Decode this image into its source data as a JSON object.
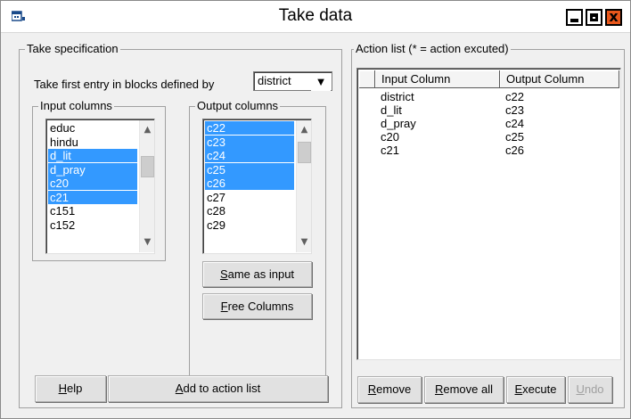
{
  "window": {
    "title": "Take data",
    "icon": "app-icon",
    "controls": [
      "minimize-icon",
      "maximize-icon",
      "close-icon"
    ],
    "close_glyph": "x"
  },
  "take_spec": {
    "group_title": "Take specification",
    "blocks_label": "Take first entry in blocks defined by",
    "blocks_value": "district",
    "dropdown_arrow": "▼",
    "input_columns": {
      "title": "Input columns",
      "items": [
        {
          "label": "educ",
          "selected": false
        },
        {
          "label": "hindu",
          "selected": false
        },
        {
          "label": "d_lit",
          "selected": true
        },
        {
          "label": "d_pray",
          "selected": true
        },
        {
          "label": "c20",
          "selected": true
        },
        {
          "label": "c21",
          "selected": true
        },
        {
          "label": "c151",
          "selected": false
        },
        {
          "label": "c152",
          "selected": false
        }
      ]
    },
    "output_columns": {
      "title": "Output columns",
      "items": [
        {
          "label": "c22",
          "selected": true
        },
        {
          "label": "c23",
          "selected": true
        },
        {
          "label": "c24",
          "selected": true
        },
        {
          "label": "c25",
          "selected": true
        },
        {
          "label": "c26",
          "selected": true
        },
        {
          "label": "c27",
          "selected": false
        },
        {
          "label": "c28",
          "selected": false
        },
        {
          "label": "c29",
          "selected": false
        }
      ]
    },
    "same_as_input": {
      "prefix": "",
      "accel": "S",
      "rest": "ame as input"
    },
    "free_columns": {
      "prefix": "",
      "accel": "F",
      "rest": "ree Columns"
    },
    "help": {
      "prefix": "",
      "accel": "H",
      "rest": "elp"
    },
    "add_to_action_list": {
      "prefix": "",
      "accel": "A",
      "rest": "dd to action list"
    }
  },
  "action_list": {
    "group_title": "Action list (* = action excuted)",
    "headers": {
      "input": "Input Column",
      "output": "Output Column"
    },
    "rows": [
      {
        "input": "district",
        "output": "c22"
      },
      {
        "input": "d_lit",
        "output": "c23"
      },
      {
        "input": "d_pray",
        "output": "c24"
      },
      {
        "input": "c20",
        "output": "c25"
      },
      {
        "input": "c21",
        "output": "c26"
      }
    ],
    "remove": {
      "prefix": "",
      "accel": "R",
      "rest": "emove"
    },
    "remove_all": {
      "prefix": "",
      "accel": "R",
      "rest": "emove all"
    },
    "execute": {
      "prefix": "",
      "accel": "E",
      "rest": "xecute"
    },
    "undo": {
      "prefix": "",
      "accel": "U",
      "rest": "ndo",
      "disabled": true
    }
  },
  "colors": {
    "selection": "#3399ff",
    "window_bg": "#f0f0f0",
    "close_button": "#e9571b"
  },
  "icons": {
    "scroll_up": "▲",
    "scroll_down": "▼"
  }
}
